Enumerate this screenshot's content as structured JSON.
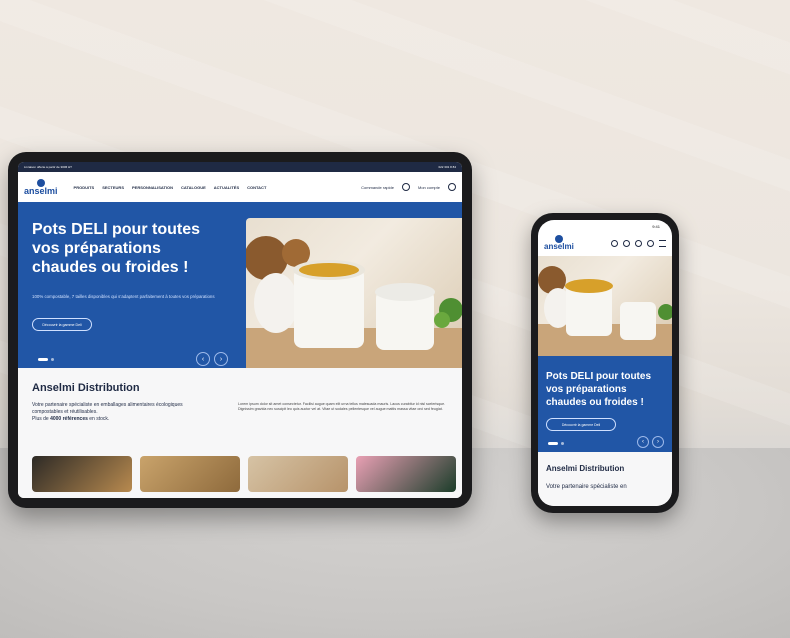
{
  "tablet": {
    "topbar": {
      "left": "Livraison offerte à partir de 300€ HT",
      "right": "022 301 8 84"
    },
    "logo": "anselmi",
    "nav": [
      "PRODUITS",
      "SECTEURS",
      "PERSONNALISATION",
      "CATALOGUE",
      "ACTUALITÉS",
      "CONTACT"
    ],
    "header_right": {
      "quick_order": "Commande rapide",
      "account": "Mon compte"
    },
    "hero": {
      "title": "Pots DELI pour toutes vos préparations chaudes ou froides !",
      "text": "100% compostable, 7 tailles disponibles qui s’adaptent parfaitement à toutes vos préparations",
      "button": "Découvrir la gamme Deli"
    },
    "section": {
      "title": "Anselmi Distribution",
      "intro_line1": "Votre partenaire spécialiste en emballages alimentaires écologiques compostables et réutilisables.",
      "intro_line2_pre": "Plus de ",
      "intro_line2_strong": "4000 références",
      "intro_line2_post": " en stock.",
      "lorem": "Lorem ipsum dolor sit amet consectetur. Facilisi augue quam elit urna tellus malesuada mauris. Lacus curabitur id nisl scelerisque. Dignissim gravida nec suscipit leo quis auctor vel at. Vitae ut sodales pellentesque vel augue mattis massa vitae orci sed feugiat."
    }
  },
  "phone": {
    "status_time": "9:41",
    "logo": "anselmi",
    "hero": {
      "title": "Pots DELI pour toutes vos préparations chaudes ou froides !",
      "button": "Découvrir la gamme Deli"
    },
    "section": {
      "title": "Anselmi Distribution",
      "text": "Votre partenaire spécialiste en"
    }
  },
  "colors": {
    "brand_blue": "#2156a6",
    "navy": "#1f2a44"
  }
}
